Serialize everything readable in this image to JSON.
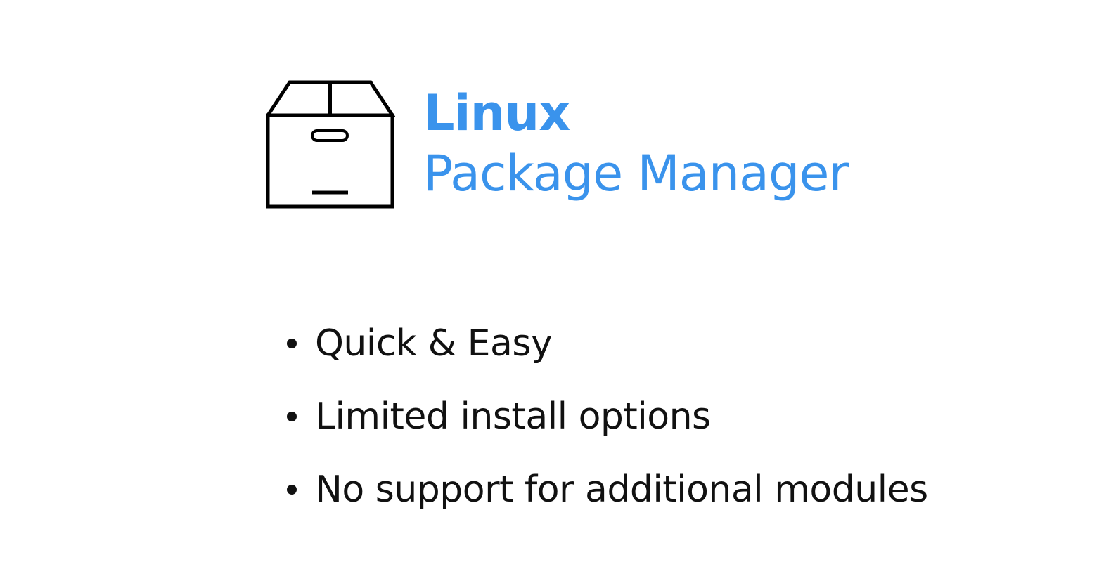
{
  "title": {
    "line1": "Linux",
    "line2": "Package Manager",
    "color": "#3a93ec"
  },
  "icon": "package-box-icon",
  "bullets": [
    {
      "text": "Quick & Easy"
    },
    {
      "text": "Limited install options"
    },
    {
      "text": "No support for additional modules"
    }
  ]
}
